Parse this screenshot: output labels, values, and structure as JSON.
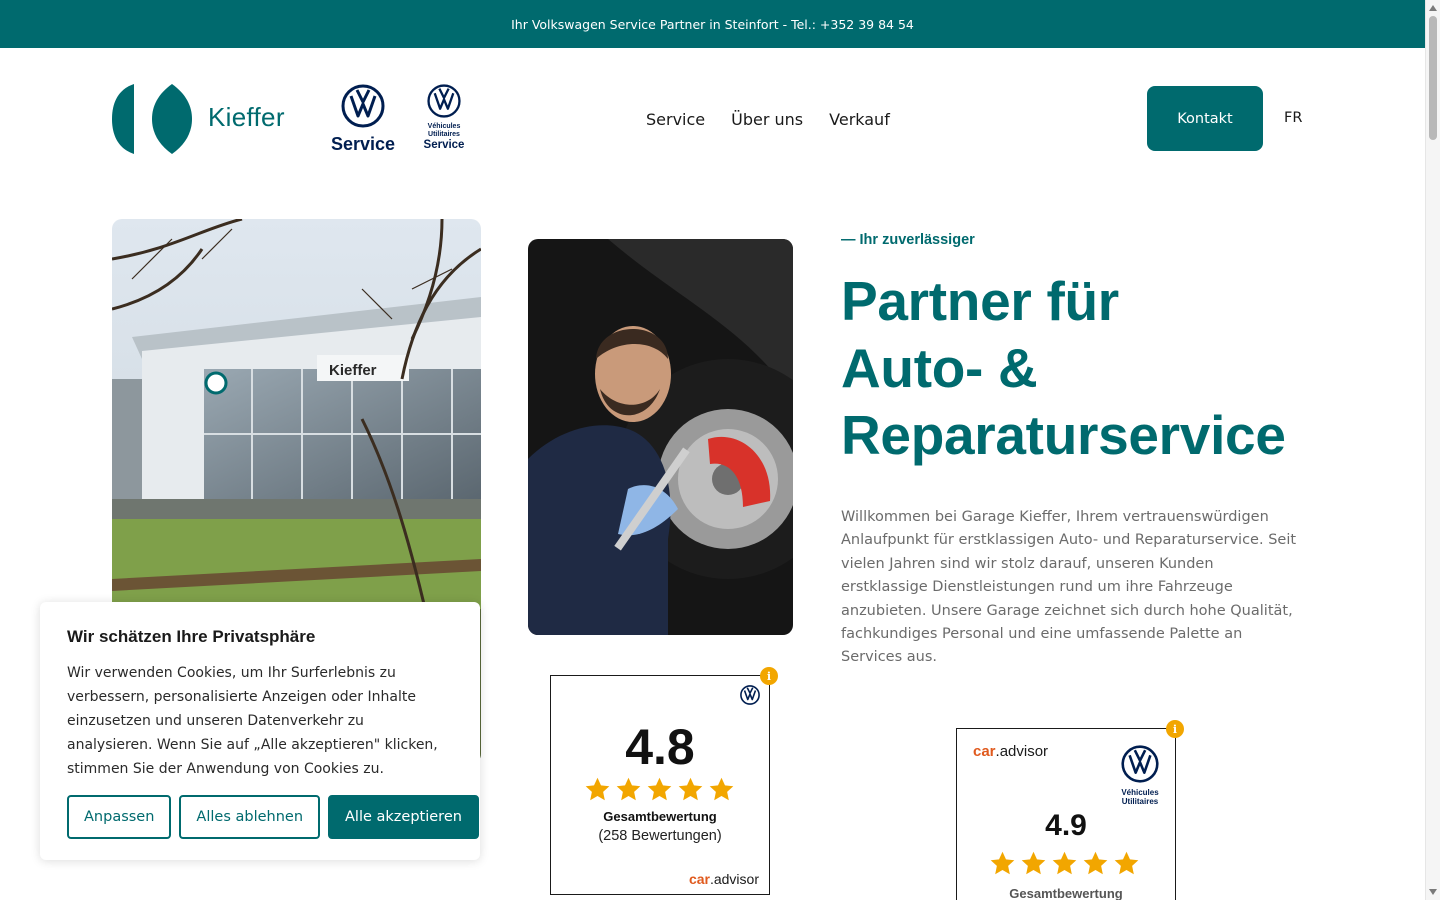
{
  "topbar": {
    "text": "Ihr Volkswagen Service Partner in Steinfort - Tel.: +352 39 84 54"
  },
  "logos": {
    "kieffer": "Kieffer",
    "vw_service_label": "Service",
    "vw_nutz_line1": "Véhicules",
    "vw_nutz_line2": "Utilitaires",
    "vw_nutz_line3": "Service"
  },
  "nav": {
    "items": [
      "Service",
      "Über uns",
      "Verkauf"
    ]
  },
  "header": {
    "contact_label": "Kontakt",
    "lang_label": "FR"
  },
  "hero": {
    "kicker": "— Ihr zuverlässiger",
    "title_line1": "Partner für",
    "title_line2": "Auto- &",
    "title_line3": "Reparaturservice",
    "intro": "Willkommen bei Garage Kieffer, Ihrem vertrauenswürdigen Anlaufpunkt für erstklassigen Auto- und Reparaturservice. Seit vielen Jahren sind wir stolz darauf, unseren Kunden erstklassige Dienstleistungen rund um ihre Fahrzeuge anzubieten. Unsere Garage zeichnet sich durch hohe Qualität, fachkundiges Personal und eine umfassende Palette an Services aus.",
    "building_sign": "Kieffer"
  },
  "rating1": {
    "score": "4.8",
    "stars": 5,
    "label": "Gesamtbewertung",
    "count": "(258 Bewertungen)",
    "brand_car": "car",
    "brand_rest": ".advisor"
  },
  "rating2": {
    "brand_car": "car",
    "brand_rest": ".advisor",
    "vw_line1": "Véhicules",
    "vw_line2": "Utilitaires",
    "score": "4.9",
    "stars": 5,
    "label": "Gesamtbewertung"
  },
  "cookie": {
    "title": "Wir schätzen Ihre Privatsphäre",
    "text": "Wir verwenden Cookies, um Ihr Surferlebnis zu verbessern, personalisierte Anzeigen oder Inhalte einzusetzen und unseren Datenverkehr zu analysieren. Wenn Sie auf „Alle akzeptieren\" klicken, stimmen Sie der Anwendung von Cookies zu.",
    "customize": "Anpassen",
    "reject": "Alles ablehnen",
    "accept": "Alle akzeptieren"
  },
  "colors": {
    "brand": "#006a6e",
    "vw_blue": "#001e50",
    "star": "#f2a600",
    "caradvisor": "#e05a1e"
  },
  "icons": {
    "info": "info-icon",
    "star": "star-icon",
    "vw": "vw-logo-icon"
  }
}
